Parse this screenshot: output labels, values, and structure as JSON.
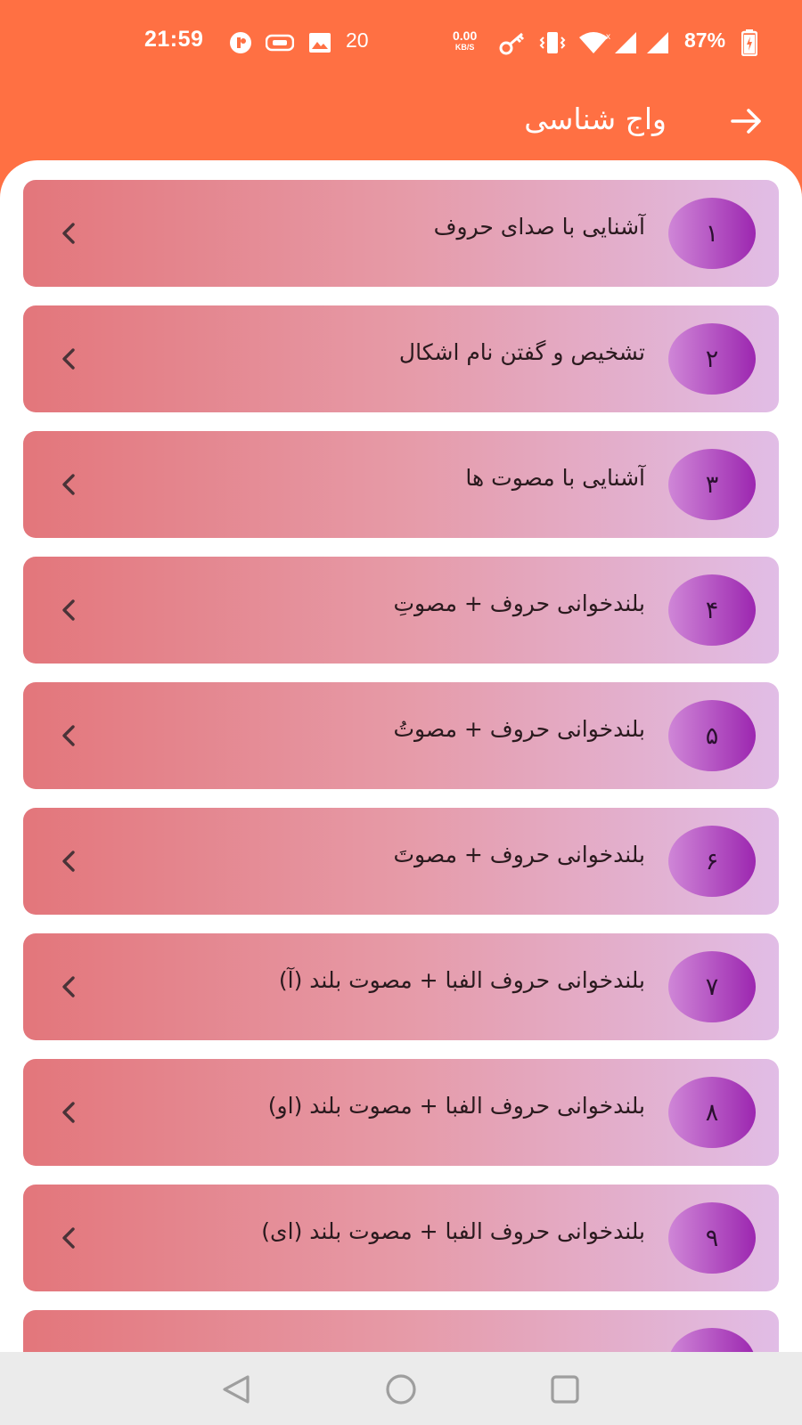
{
  "status_bar": {
    "time": "21:59",
    "notification_count": "20",
    "net_speed_value": "0.00",
    "net_speed_unit": "KB/S",
    "battery_percent": "87%"
  },
  "app_bar": {
    "title": "واج شناسی",
    "back_icon": "arrow-right-icon"
  },
  "lessons": [
    {
      "number": "۱",
      "title": "آشنایی با صدای حروف"
    },
    {
      "number": "۲",
      "title": "تشخیص و گفتن نام اشکال"
    },
    {
      "number": "۳",
      "title": "آشنایی با مصوت ها"
    },
    {
      "number": "۴",
      "title": "بلندخوانی حروف + مصوتِ"
    },
    {
      "number": "۵",
      "title": "بلندخوانی حروف + مصوتُ"
    },
    {
      "number": "۶",
      "title": "بلندخوانی حروف + مصوتَ"
    },
    {
      "number": "۷",
      "title": "بلندخوانی حروف الفبا + مصوت بلند (آ)"
    },
    {
      "number": "۸",
      "title": "بلندخوانی حروف الفبا + مصوت بلند (او)"
    },
    {
      "number": "۹",
      "title": "بلندخوانی حروف الفبا + مصوت بلند (ای)"
    },
    {
      "number": "",
      "title": ""
    }
  ],
  "colors": {
    "header": "#ff7043",
    "card_gradient_start": "#e3767b",
    "card_gradient_end": "#e1bde6",
    "badge_gradient_start": "#cf86d7",
    "badge_gradient_end": "#9c27b0",
    "nav_bar": "#ebebeb"
  },
  "nav_bar": {
    "back_icon": "triangle-back-icon",
    "home_icon": "circle-home-icon",
    "recents_icon": "square-recents-icon"
  }
}
